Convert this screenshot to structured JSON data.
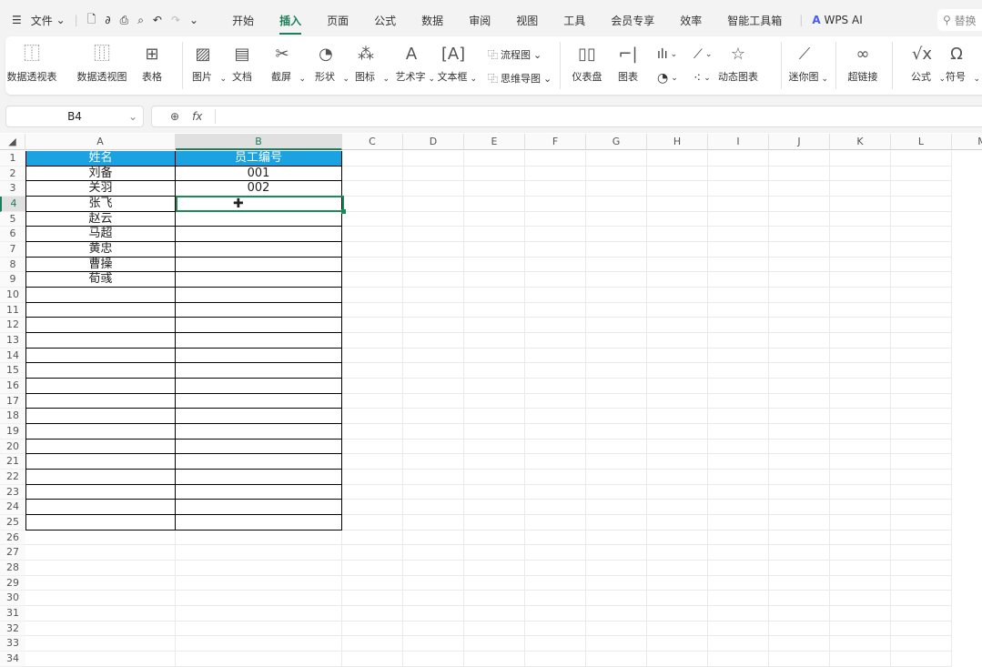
{
  "menu": {
    "hamburger": "☰",
    "file": "文件",
    "quick": [
      "save",
      "link",
      "print",
      "preview",
      "undo",
      "redo",
      "more"
    ]
  },
  "tabs": [
    "开始",
    "插入",
    "页面",
    "公式",
    "数据",
    "审阅",
    "视图",
    "工具",
    "会员专享",
    "效率",
    "智能工具箱"
  ],
  "active_tab": "插入",
  "wps_ai": "WPS AI",
  "search_placeholder": "替换",
  "ribbon": {
    "big": [
      {
        "label": "数据透视表",
        "icon": "pivot-table"
      },
      {
        "label": "数据透视图",
        "icon": "pivot-chart"
      },
      {
        "label": "表格",
        "icon": "table"
      },
      {
        "label": "图片",
        "icon": "picture"
      },
      {
        "label": "文档",
        "icon": "document"
      },
      {
        "label": "截屏",
        "icon": "screenshot"
      },
      {
        "label": "形状",
        "icon": "shape"
      },
      {
        "label": "图标",
        "icon": "icons"
      },
      {
        "label": "艺术字",
        "icon": "wordart"
      },
      {
        "label": "文本框",
        "icon": "textbox"
      },
      {
        "label": "仪表盘",
        "icon": "dashboard"
      },
      {
        "label": "图表",
        "icon": "chart"
      },
      {
        "label": "动态图表",
        "icon": "dynamic-chart"
      },
      {
        "label": "迷你图",
        "icon": "sparkline"
      },
      {
        "label": "超链接",
        "icon": "hyperlink"
      },
      {
        "label": "公式",
        "icon": "formula"
      },
      {
        "label": "符号",
        "icon": "symbol"
      }
    ],
    "small": {
      "flowchart": "流程图",
      "mindmap": "思维导图"
    }
  },
  "formula_bar": {
    "name_box": "B4",
    "fx": "fx",
    "value": ""
  },
  "columns": [
    "A",
    "B",
    "C",
    "D",
    "E",
    "F",
    "G",
    "H",
    "I",
    "J",
    "K",
    "L",
    "M"
  ],
  "selected_cell": "B4",
  "header_color": "#1aa3e0",
  "sheet": {
    "headers": [
      "姓名",
      "员工编号"
    ],
    "rows": [
      [
        "刘备",
        "001"
      ],
      [
        "关羽",
        "002"
      ],
      [
        "张飞",
        ""
      ],
      [
        "赵云",
        ""
      ],
      [
        "马超",
        ""
      ],
      [
        "黄忠",
        ""
      ],
      [
        "曹操",
        ""
      ],
      [
        "荀彧",
        ""
      ]
    ]
  },
  "row_count": 34
}
